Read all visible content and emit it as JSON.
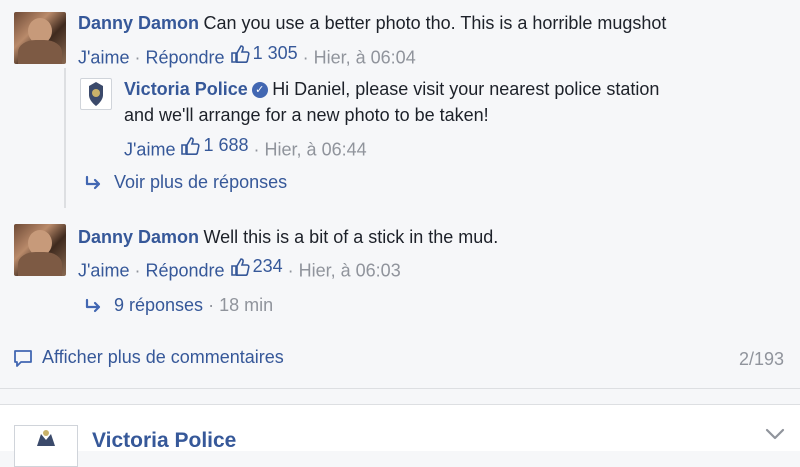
{
  "comments": [
    {
      "author": "Danny Damon",
      "text": "Can you use a better photo tho. This is a horrible mugshot",
      "like_label": "J'aime",
      "reply_label": "Répondre",
      "likes": "1 305",
      "time": "Hier, à 06:04",
      "replies": [
        {
          "author": "Victoria Police",
          "text_line1": "Hi Daniel, please visit your nearest police station",
          "text_line2": "and we'll arrange for a new photo to be taken!",
          "like_label": "J'aime",
          "likes": "1 688",
          "time": "Hier, à 06:44"
        }
      ],
      "more_replies_label": "Voir plus de réponses"
    },
    {
      "author": "Danny Damon",
      "text": "Well this is a bit of a stick in the mud.",
      "like_label": "J'aime",
      "reply_label": "Répondre",
      "likes": "234",
      "time": "Hier, à 06:03",
      "replies_label": "9 réponses",
      "replies_time": "18 min"
    }
  ],
  "footer": {
    "more_comments_label": "Afficher plus de commentaires",
    "count": "2/193"
  },
  "next_post": {
    "author": "Victoria Police"
  },
  "separators": {
    "dot": "·"
  },
  "colors": {
    "link": "#365899",
    "meta": "#90949c",
    "verified": "#4267b2"
  }
}
